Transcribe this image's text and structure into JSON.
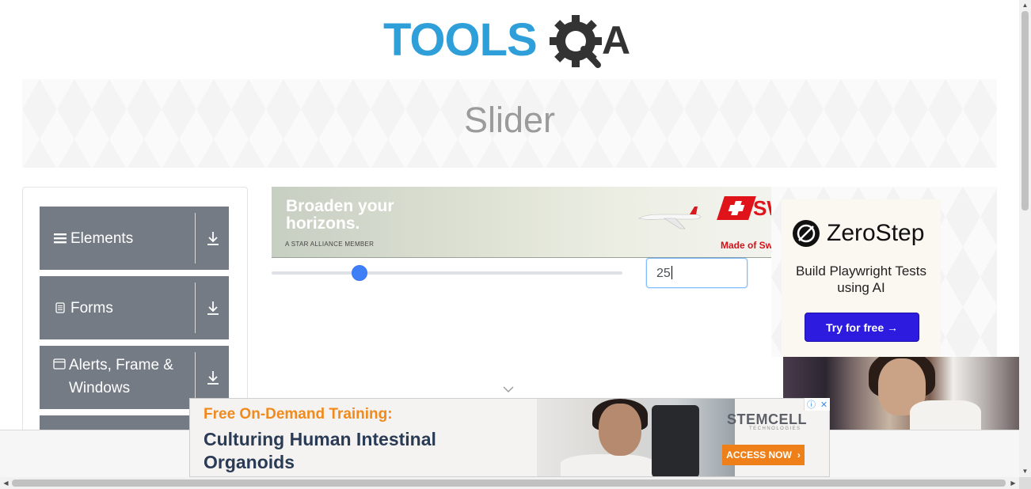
{
  "logo": {
    "part1": "TOOLS",
    "part2": "A",
    "icon": "gear-magnifier-icon",
    "color_blue": "#2f9fd9",
    "color_dark": "#333333"
  },
  "header": {
    "title": "Slider"
  },
  "sidebar": {
    "groups": [
      {
        "label": "Elements",
        "icon": "hamburger-icon"
      },
      {
        "label": "Forms",
        "icon": "document-icon"
      },
      {
        "label": "Alerts, Frame & Windows",
        "icon": "window-icon"
      },
      {
        "label": "",
        "icon": ""
      }
    ]
  },
  "slider": {
    "value": "25",
    "value_fraction": 0.25,
    "min": 0,
    "max": 100
  },
  "ads": {
    "top": {
      "headline": "Broaden your horizons.",
      "member": "A STAR ALLIANCE MEMBER",
      "brand": "SW",
      "tagline": "Made of Sw"
    },
    "side": {
      "brand": "ZeroStep",
      "tagline": "Build Playwright Tests using AI",
      "button": "Try for free →"
    },
    "bottom": {
      "kicker": "Free On-Demand Training:",
      "headline": "Culturing Human Intestinal Organoids",
      "brand": "STEMCELL",
      "brand_sub": "TECHNOLOGIES",
      "cta": "ACCESS NOW"
    }
  },
  "colors": {
    "sidebar_bg": "#747b84",
    "slider_thumb": "#3e7ef7",
    "zerostep_button": "#2d1be0",
    "accent_orange": "#f08a1c"
  }
}
